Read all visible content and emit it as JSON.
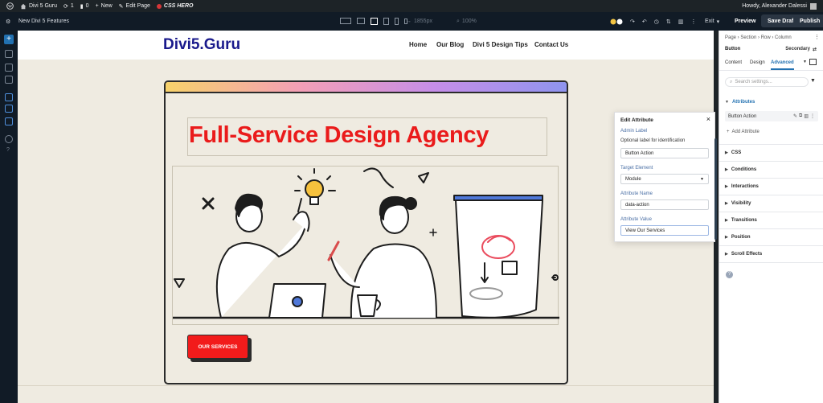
{
  "wp_bar": {
    "site_name": "Divi 5 Guru",
    "updates_count": "1",
    "comments_count": "0",
    "new_label": "New",
    "edit_page_label": "Edit Page",
    "plugin_label": "CSS HERO",
    "greeting": "Howdy, Alexander Dalessi"
  },
  "builder_toolbar": {
    "page_title": "New Divi 5 Features",
    "width_readout": "1855px",
    "zoom_readout": "100%",
    "exit_label": "Exit",
    "preview_label": "Preview",
    "save_draft_label": "Save Draft",
    "publish_label": "Publish"
  },
  "site": {
    "logo": "Divi5.Guru",
    "nav": [
      "Home",
      "Our Blog",
      "Divi 5 Design Tips",
      "Contact Us"
    ],
    "headline": "Full-Service Design Agency",
    "button_label": "OUR SERVICES"
  },
  "edit_attribute": {
    "title": "Edit Attribute",
    "admin_label_heading": "Admin Label",
    "admin_label_help": "Optional label for identification",
    "admin_label_value": "Button Action",
    "target_heading": "Target Element",
    "target_value": "Module",
    "name_heading": "Attribute Name",
    "name_value": "data-action",
    "value_heading": "Attribute Value",
    "value_value": "View Our Services"
  },
  "settings_panel": {
    "breadcrumb": "Page › Section › Row › Column",
    "module_name": "Button",
    "preset_label": "Secondary",
    "tabs": [
      "Content",
      "Design",
      "Advanced"
    ],
    "active_tab": "Advanced",
    "search_placeholder": "Search settings...",
    "attributes_heading": "Attributes",
    "attribute_item": "Button Action",
    "add_attribute_label": "Add Attribute",
    "sections": [
      "CSS",
      "Conditions",
      "Interactions",
      "Visibility",
      "Transitions",
      "Position",
      "Scroll Effects"
    ]
  },
  "colors": {
    "accent": "#2271b1",
    "headline": "#ea1b1b",
    "button": "#f21b1b",
    "logo": "#1a1a8c"
  }
}
